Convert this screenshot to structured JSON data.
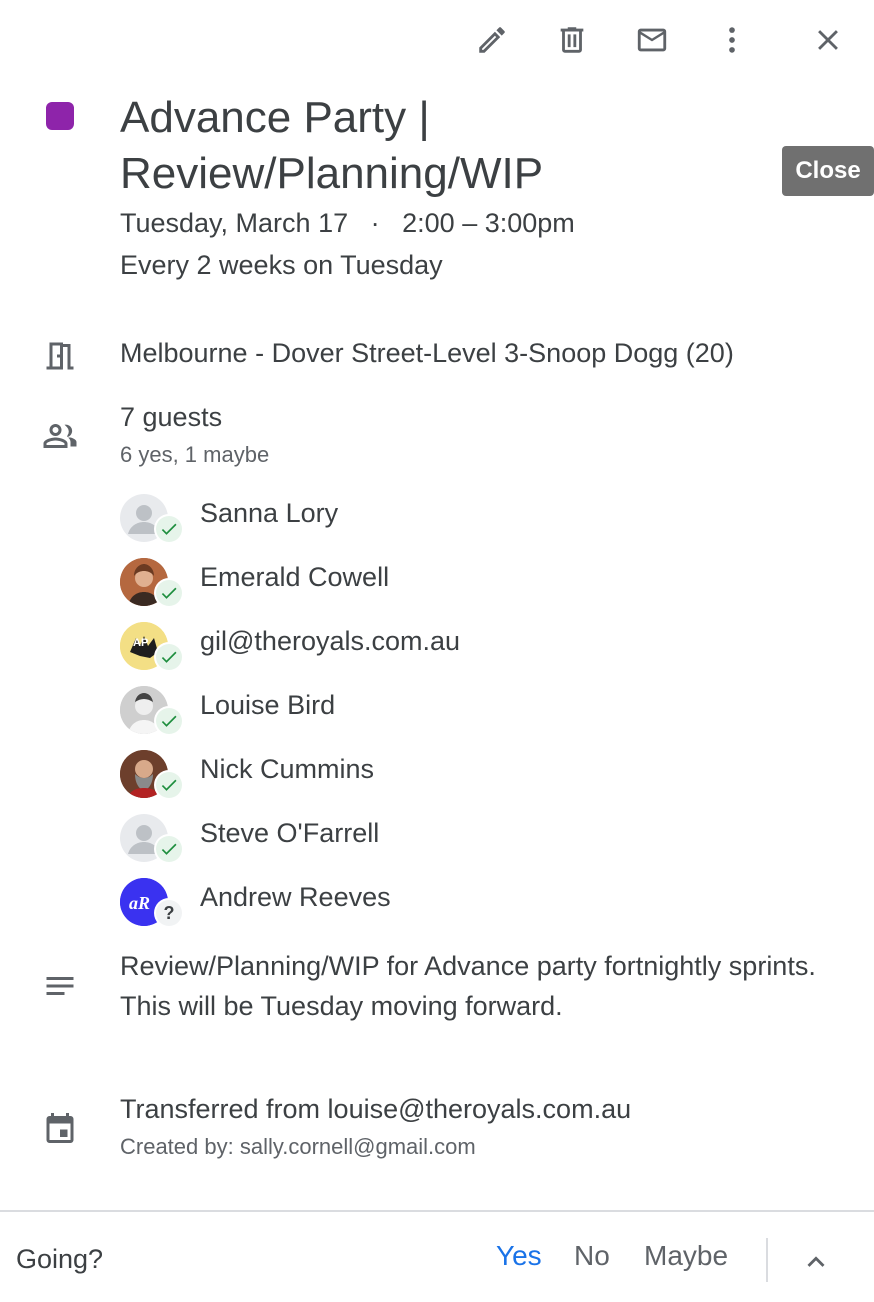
{
  "toolbar": {
    "edit_icon": "pencil-icon",
    "delete_icon": "trash-icon",
    "email_icon": "mail-icon",
    "more_icon": "more-vert-icon",
    "close_icon": "close-icon"
  },
  "tooltip": {
    "close_label": "Close"
  },
  "event": {
    "color": "#8e24aa",
    "title": "Advance Party | Review/Planning/WIP",
    "date": "Tuesday, March 17",
    "separator": "·",
    "time": "2:00 – 3:00pm",
    "recurrence": "Every 2 weeks on Tuesday",
    "location": "Melbourne - Dover Street-Level 3-Snoop Dogg (20)"
  },
  "guests": {
    "count_label": "7 guests",
    "summary": "6 yes, 1 maybe",
    "list": [
      {
        "name": "Sanna Lory",
        "status": "yes"
      },
      {
        "name": "Emerald Cowell",
        "status": "yes"
      },
      {
        "name": "gil@theroyals.com.au",
        "status": "yes"
      },
      {
        "name": "Louise Bird",
        "status": "yes"
      },
      {
        "name": "Nick Cummins",
        "status": "yes"
      },
      {
        "name": "Steve O'Farrell",
        "status": "yes"
      },
      {
        "name": "Andrew Reeves",
        "status": "maybe",
        "initials": "aR"
      }
    ]
  },
  "description": {
    "line1": "Review/Planning/WIP for Advance party fortnightly sprints.",
    "line2": "This will be Tuesday moving forward."
  },
  "calendar": {
    "source": "Transferred from louise@theroyals.com.au",
    "created_by": "Created by: sally.cornell@gmail.com"
  },
  "footer": {
    "going_label": "Going?",
    "yes": "Yes",
    "no": "No",
    "maybe": "Maybe"
  },
  "colors": {
    "accent": "#1a73e8",
    "yes_badge": "#1e8e3e",
    "icon": "#5f6368"
  }
}
